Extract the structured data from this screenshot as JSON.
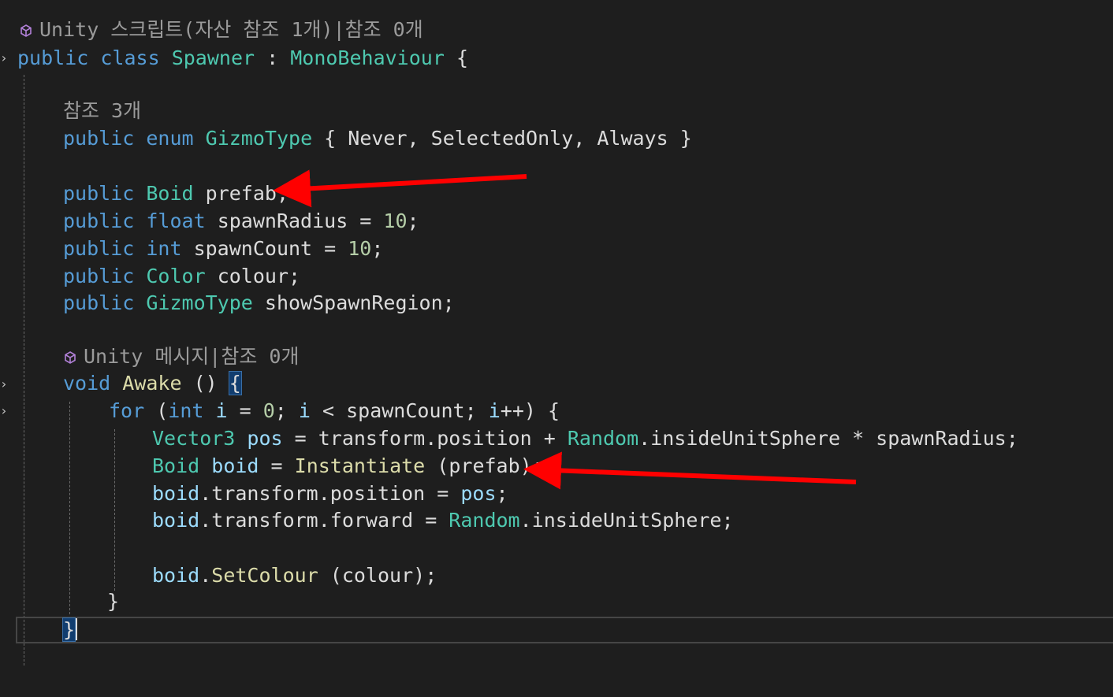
{
  "code_lens": {
    "class": "Unity 스크립트(자산 참조 1개)|참조 0개",
    "enum": "참조 3개",
    "awake": "Unity 메시지|참조 0개"
  },
  "lines": {
    "class_decl": [
      "public",
      " ",
      "class",
      " ",
      "Spawner",
      " : ",
      "MonoBehaviour",
      " {"
    ],
    "enum_decl": [
      "public",
      " ",
      "enum",
      " ",
      "GizmoType",
      " { Never, SelectedOnly, Always }"
    ],
    "field_prefab": [
      "public",
      " ",
      "Boid",
      " prefab;"
    ],
    "field_radius": [
      "public",
      " ",
      "float",
      " spawnRadius = ",
      "10",
      ";"
    ],
    "field_count": [
      "public",
      " ",
      "int",
      " spawnCount = ",
      "10",
      ";"
    ],
    "field_colour": [
      "public",
      " ",
      "Color",
      " colour;"
    ],
    "field_gizmo": [
      "public",
      " ",
      "GizmoType",
      " showSpawnRegion;"
    ],
    "awake_decl": [
      "void",
      " ",
      "Awake",
      " () ",
      "{"
    ],
    "for_line": [
      "for",
      " (",
      "int",
      " ",
      "i",
      " = ",
      "0",
      "; ",
      "i",
      " < spawnCount; ",
      "i",
      "++) {"
    ],
    "pos_line": [
      "Vector3",
      " ",
      "pos",
      " = transform.position + ",
      "Random",
      ".insideUnitSphere * spawnRadius;"
    ],
    "instantiate_line": [
      "Boid",
      " ",
      "boid",
      " = ",
      "Instantiate",
      " (prefab);"
    ],
    "position_line": [
      "boid",
      ".transform.position = ",
      "pos",
      ";"
    ],
    "forward_line": [
      "boid",
      ".transform.forward = ",
      "Random",
      ".insideUnitSphere;"
    ],
    "setcolour_line": [
      "boid",
      ".",
      "SetColour",
      " (colour);"
    ],
    "close_for": [
      "}"
    ],
    "close_awake": [
      "}"
    ]
  },
  "annotations": {
    "arrow_color": "#ff0000"
  },
  "colors": {
    "background": "#1e1e1e",
    "keyword": "#569cd6",
    "type": "#4ec9b0",
    "method": "#dcdcaa",
    "variable": "#9cdcfe",
    "number": "#b5cea8",
    "plain": "#dcdcdc"
  }
}
